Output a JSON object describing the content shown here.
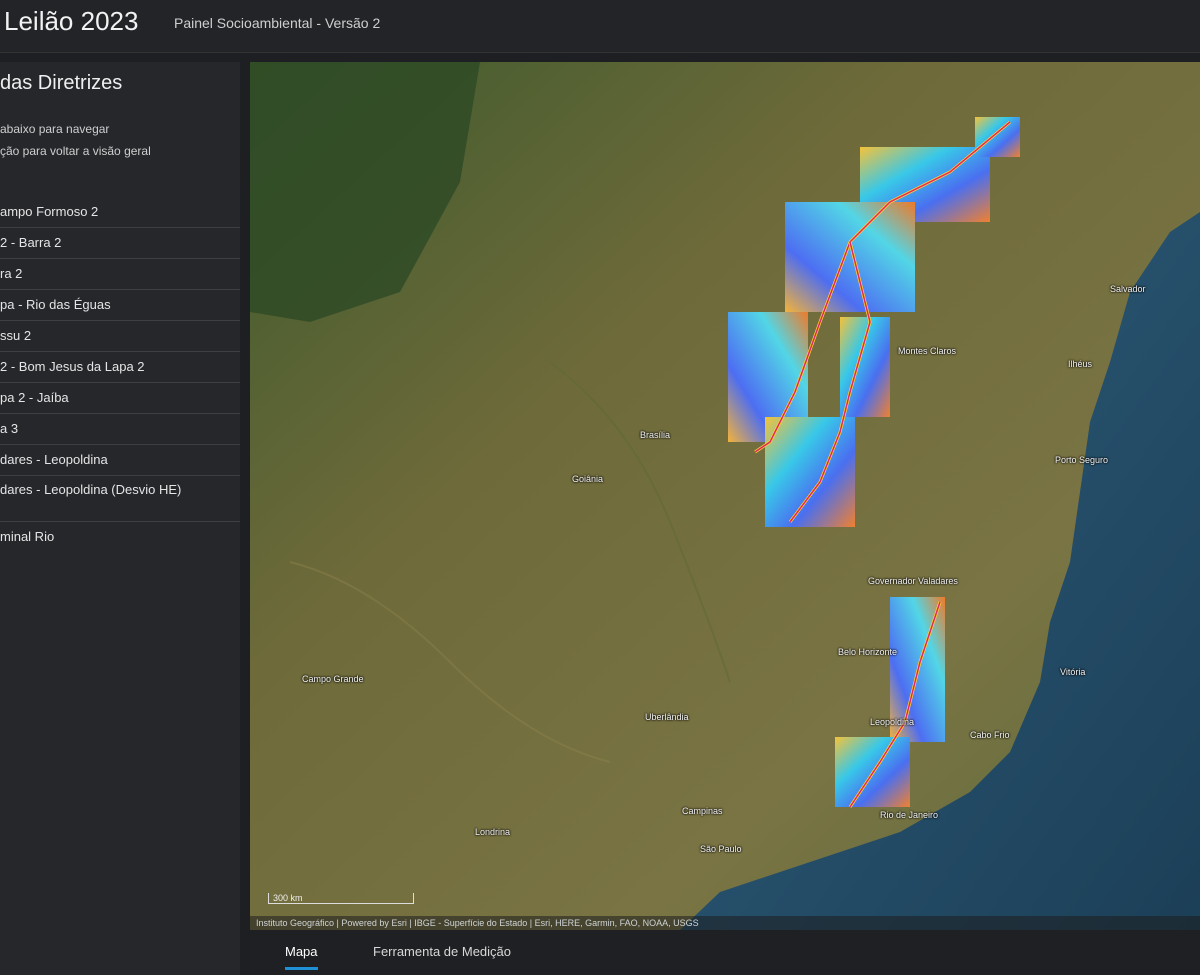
{
  "header": {
    "title": "Leilão 2023",
    "subtitle": "Painel Socioambiental - Versão 2"
  },
  "sidebar": {
    "title": "das Diretrizes",
    "hint_line1": "abaixo para navegar",
    "hint_line2": "ção para voltar a visão geral",
    "items": [
      {
        "label": "ampo Formoso 2"
      },
      {
        "label": "2 - Barra 2"
      },
      {
        "label": "ra 2"
      },
      {
        "label": "pa - Rio das Éguas"
      },
      {
        "label": "ssu 2"
      },
      {
        "label": "2 - Bom Jesus da Lapa 2"
      },
      {
        "label": "pa 2 - Jaíba"
      },
      {
        "label": "a 3"
      },
      {
        "label": "dares - Leopoldina"
      },
      {
        "label": "dares - Leopoldina (Desvio HE)"
      },
      {
        "label": "minal Rio"
      }
    ]
  },
  "map": {
    "attribution": "Instituto Geográfico | Powered by Esri | IBGE - Superfície do Estado | Esri, HERE, Garmin, FAO, NOAA, USGS",
    "scale_label": "300 km",
    "labels": [
      {
        "text": "Salvador"
      },
      {
        "text": "Brasília"
      },
      {
        "text": "Goiânia"
      },
      {
        "text": "Belo Horizonte"
      },
      {
        "text": "Rio de Janeiro"
      },
      {
        "text": "Campinas"
      },
      {
        "text": "São Paulo"
      },
      {
        "text": "Vitória"
      },
      {
        "text": "Campo Grande"
      },
      {
        "text": "Londrina"
      },
      {
        "text": "Montes Claros"
      },
      {
        "text": "Governador Valadares"
      },
      {
        "text": "Uberlândia"
      },
      {
        "text": "Porto Seguro"
      },
      {
        "text": "Leopoldina"
      },
      {
        "text": "Ilhéus"
      },
      {
        "text": "Cabo Frio"
      }
    ]
  },
  "tabs": [
    {
      "label": "Mapa"
    },
    {
      "label": "Ferramenta de Medição"
    }
  ]
}
